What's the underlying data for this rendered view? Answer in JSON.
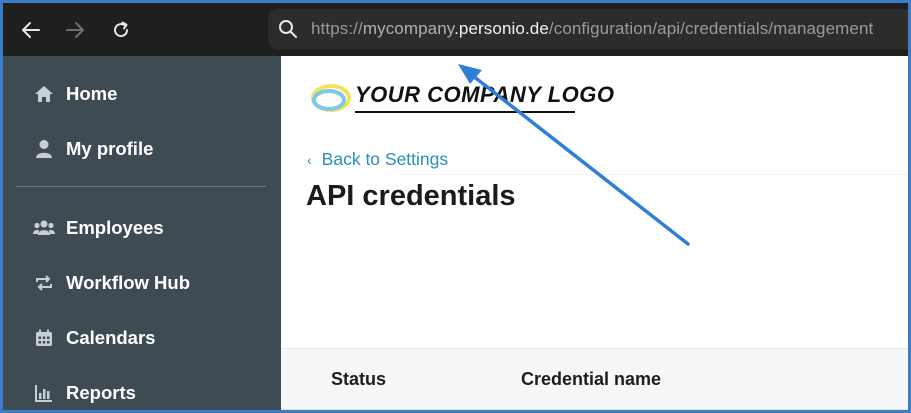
{
  "browser": {
    "url": {
      "scheme": "https://",
      "subdomain": "mycompany",
      "domain": ".personio.de",
      "path": "/configuration/api/credentials/management"
    }
  },
  "sidebar": {
    "items": [
      {
        "label": "Home",
        "icon": "home-icon"
      },
      {
        "label": "My profile",
        "icon": "person-icon"
      },
      {
        "label": "Employees",
        "icon": "people-icon"
      },
      {
        "label": "Workflow Hub",
        "icon": "workflow-icon"
      },
      {
        "label": "Calendars",
        "icon": "calendar-icon"
      },
      {
        "label": "Reports",
        "icon": "reports-icon"
      }
    ]
  },
  "main": {
    "logo_text": "YOUR COMPANY LOGO",
    "back_label": "Back to Settings",
    "title": "API credentials",
    "table": {
      "columns": [
        "Status",
        "Credential name"
      ]
    }
  },
  "colors": {
    "sidebar_bg": "#3f4b52",
    "link": "#2a8fb8",
    "annotation": "#2f7fd8",
    "toolbar_bg": "#1f1f1f"
  }
}
